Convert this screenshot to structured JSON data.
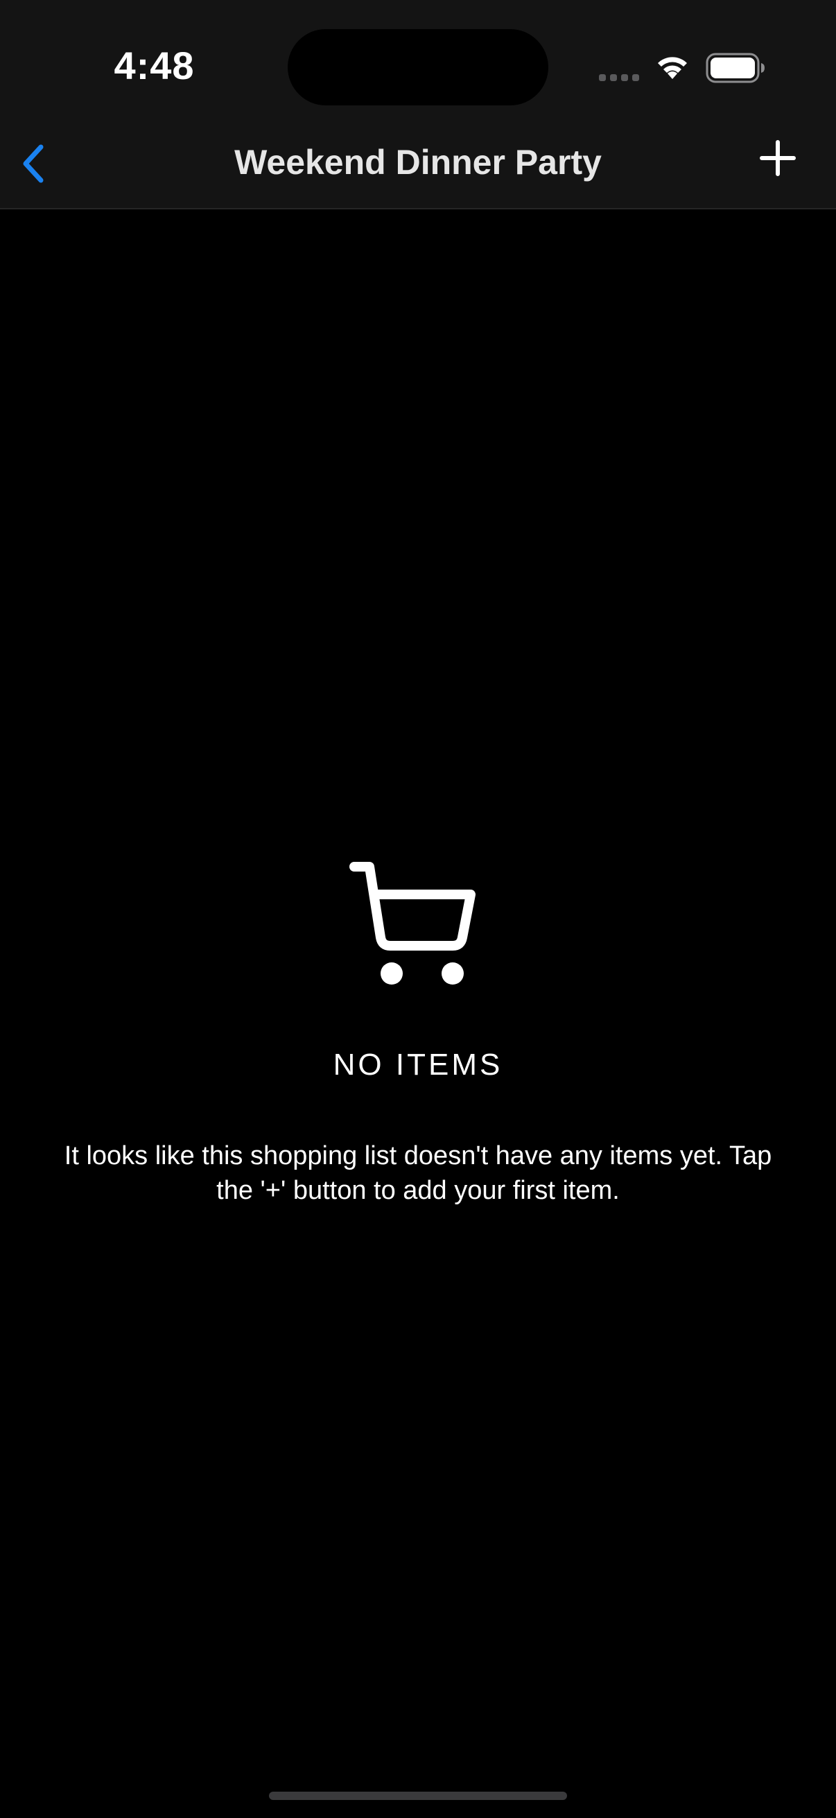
{
  "status_bar": {
    "time": "4:48",
    "icons": [
      "cellular-signal-icon",
      "wifi-icon",
      "battery-icon"
    ]
  },
  "nav_bar": {
    "title": "Weekend Dinner Party",
    "back_icon": "chevron-left-icon",
    "add_icon": "plus-icon"
  },
  "empty_state": {
    "icon": "shopping-cart-icon",
    "title": "NO ITEMS",
    "message": "It looks like this shopping list doesn't have any items yet. Tap the '+' button to add your first item."
  },
  "colors": {
    "background": "#000000",
    "nav_background": "#141414",
    "accent": "#1a82f0",
    "text": "#ffffff"
  }
}
